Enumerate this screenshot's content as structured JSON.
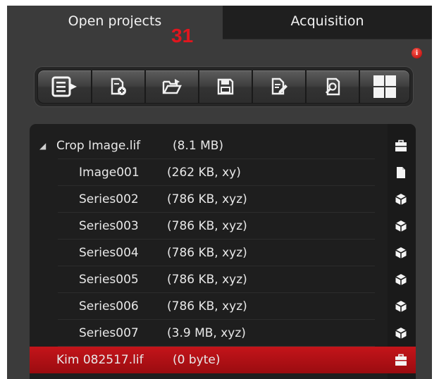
{
  "tabs": {
    "open_projects": "Open projects",
    "acquisition": "Acquisition",
    "badge": "31"
  },
  "info_badge": "i",
  "toolbar": {
    "buttons": [
      {
        "icon": "export-list-icon"
      },
      {
        "icon": "new-file-icon"
      },
      {
        "icon": "open-folder-icon"
      },
      {
        "icon": "save-icon"
      },
      {
        "icon": "edit-document-icon"
      },
      {
        "icon": "search-document-icon"
      },
      {
        "icon": "grid-view-icon"
      }
    ]
  },
  "projects": [
    {
      "name": "Crop Image.lif",
      "meta": "(8.1 MB)",
      "icon": "briefcase-icon",
      "expanded": true,
      "children": [
        {
          "name": "Image001",
          "meta": "(262 KB, xy)",
          "icon": "document-icon"
        },
        {
          "name": "Series002",
          "meta": "(786 KB, xyz)",
          "icon": "cube-icon"
        },
        {
          "name": "Series003",
          "meta": "(786 KB, xyz)",
          "icon": "cube-icon"
        },
        {
          "name": "Series004",
          "meta": "(786 KB, xyz)",
          "icon": "cube-icon"
        },
        {
          "name": "Series005",
          "meta": "(786 KB, xyz)",
          "icon": "cube-icon"
        },
        {
          "name": "Series006",
          "meta": "(786 KB, xyz)",
          "icon": "cube-icon"
        },
        {
          "name": "Series007",
          "meta": "(3.9 MB, xyz)",
          "icon": "cube-icon"
        }
      ]
    },
    {
      "name": "Kim 082517.lif",
      "meta": "(0 byte)",
      "icon": "briefcase-icon",
      "selected": true
    }
  ],
  "colors": {
    "selected_row": "#b01015",
    "badge_red": "#e0161e",
    "panel_bg": "#3b3b3b",
    "list_bg": "#1e1e1e"
  }
}
